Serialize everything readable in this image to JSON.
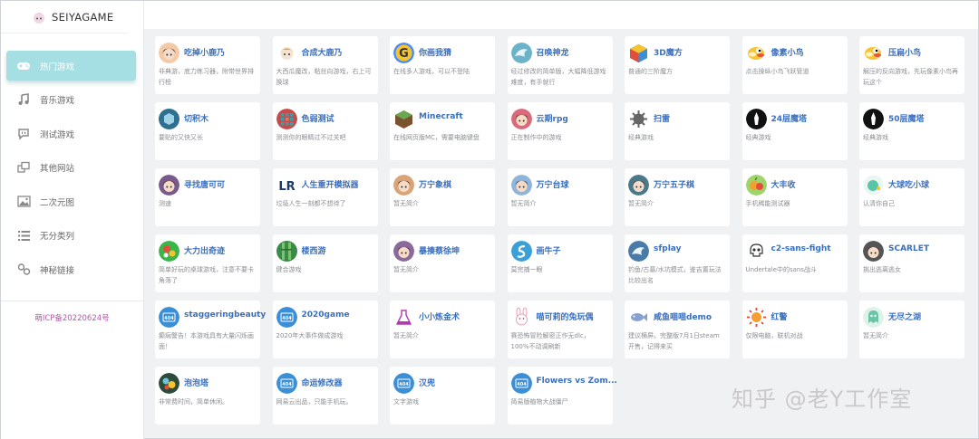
{
  "app": {
    "logo_text": "SEIYAGAME",
    "icp": "萌ICP备20220624号"
  },
  "sidebar": {
    "items": [
      {
        "label": "热门游戏",
        "icon": "gamepad-icon",
        "active": true
      },
      {
        "label": "音乐游戏",
        "icon": "music-note-icon",
        "active": false
      },
      {
        "label": "测试游戏",
        "icon": "chat-icon",
        "active": false
      },
      {
        "label": "其他网站",
        "icon": "windows-icon",
        "active": false
      },
      {
        "label": "二次元图",
        "icon": "image-icon",
        "active": false
      },
      {
        "label": "无分类列",
        "icon": "list-icon",
        "active": false
      },
      {
        "label": "神秘链接",
        "icon": "link-icon",
        "active": false
      }
    ]
  },
  "games": [
    {
      "title": "吃掉小鹿乃",
      "desc": "非典游，底力练习器，附带世界排行榜",
      "icon": "anime-girl-icon",
      "color": "#f4c9a8"
    },
    {
      "title": "合成大鹿乃",
      "desc": "大西瓜魔改，粘丝向游戏，右上可换球",
      "icon": "chibi-icon",
      "color": "#f2e4d0"
    },
    {
      "title": "你画我猜",
      "desc": "在线多人游戏，可以不登陆",
      "icon": "g-logo-icon",
      "color": "#4b8bf5"
    },
    {
      "title": "召唤神龙",
      "desc": "经过修改的简单版，大幅降低游戏难度，有手就行",
      "icon": "dragon-icon",
      "color": "#6ab3c9"
    },
    {
      "title": "3D魔方",
      "desc": "普通的三阶魔方",
      "icon": "rubik-cube-icon",
      "color": "#e44d3a"
    },
    {
      "title": "像素小鸟",
      "desc": "点击操纵小鸟飞跃管道",
      "icon": "flappy-bird-icon",
      "color": "#f6c43a"
    },
    {
      "title": "压扁小鸟",
      "desc": "解压的反向游戏，先玩像素小鸟再玩这个",
      "icon": "flappy-bird-icon",
      "color": "#f6c43a"
    },
    {
      "title": "切积木",
      "desc": "要贴的又快又长",
      "icon": "cube-icon",
      "color": "#2f6f8f"
    },
    {
      "title": "色弱测试",
      "desc": "测测你的眼睛过不过关吧",
      "icon": "grid-icon",
      "color": "#c94a4a"
    },
    {
      "title": "Minecraft",
      "desc": "在线网页版MC，需要电脑键盘",
      "icon": "grass-block-icon",
      "color": "#6aa84f"
    },
    {
      "title": "云期rpg",
      "desc": "正在制作中的游戏",
      "icon": "anime-girl-icon",
      "color": "#d86a7a"
    },
    {
      "title": "扫雷",
      "desc": "经典游戏",
      "icon": "mine-icon",
      "color": "#888888"
    },
    {
      "title": "24层魔塔",
      "desc": "经典游戏",
      "icon": "tower-icon",
      "color": "#111111"
    },
    {
      "title": "50层魔塔",
      "desc": "经典游戏",
      "icon": "tower-icon",
      "color": "#111111"
    },
    {
      "title": "寻找唐可可",
      "desc": "测速",
      "icon": "anime-face-icon",
      "color": "#7a5a8a"
    },
    {
      "title": "人生重开模拟器",
      "desc": "垃圾人生一刻都不想待了",
      "icon": "lr-logo-icon",
      "color": "#ffffff"
    },
    {
      "title": "万宁象棋",
      "desc": "暂无简介",
      "icon": "anime-face-icon",
      "color": "#d9a47a"
    },
    {
      "title": "万宁台球",
      "desc": "暂无简介",
      "icon": "anime-face-icon",
      "color": "#8fb6d9"
    },
    {
      "title": "万宁五子棋",
      "desc": "暂无简介",
      "icon": "anime-face-icon",
      "color": "#4a7a8a"
    },
    {
      "title": "大丰收",
      "desc": "手机稀能测试器",
      "icon": "fruit-icon",
      "color": "#e8b43a"
    },
    {
      "title": "大球吃小球",
      "desc": "认清你自己",
      "icon": "ball-icon",
      "color": "#58c4a8"
    },
    {
      "title": "大力出奇迹",
      "desc": "简单好玩的桌球游戏，注意不要卡角落了",
      "icon": "billiard-icon",
      "color": "#3ab54a"
    },
    {
      "title": "楼西游",
      "desc": "健合游戏",
      "icon": "bamboo-icon",
      "color": "#3a8a4a"
    },
    {
      "title": "暴揍蔡徐坤",
      "desc": "暂无简介",
      "icon": "anime-face-icon",
      "color": "#8a6a9a"
    },
    {
      "title": "画牛子",
      "desc": "莫完捕一眼",
      "icon": "s-curve-icon",
      "color": "#3aa0d9"
    },
    {
      "title": "sfplay",
      "desc": "钓鱼/古墓/水坑模式，鉴吉置玩法比较出名",
      "icon": "dragon-icon",
      "color": "#4a7aa8"
    },
    {
      "title": "c2-sans-fight",
      "desc": "Undertale中的sans战斗",
      "icon": "skull-icon",
      "color": "#ffffff"
    },
    {
      "title": "SCARLET",
      "desc": "挑出逃离逃女",
      "icon": "anime-face-icon",
      "color": "#555555"
    },
    {
      "title": "staggeringbeauty",
      "desc": "癫痫警告！本游戏具有大量闪烁画面！",
      "icon": "404-icon",
      "color": "#3a8fd6"
    },
    {
      "title": "2020game",
      "desc": "2020年大事件做成游戏",
      "icon": "404-icon",
      "color": "#3a8fd6"
    },
    {
      "title": "小小炼金术",
      "desc": "暂无简介",
      "icon": "flask-icon",
      "color": "#b03ab0"
    },
    {
      "title": "喵可莉的兔玩偶",
      "desc": "赛恐怖冒险解密正作无dlc，100%不动调刷新",
      "icon": "bunny-icon",
      "color": "#e8a0b0"
    },
    {
      "title": "咸鱼喵喵demo",
      "desc": "建议横屏。完整版7月1日steam开售，记得来买",
      "icon": "fish-icon",
      "color": "#8aa0d0"
    },
    {
      "title": "红警",
      "desc": "仅限电脑，联机对战",
      "icon": "sun-icon",
      "color": "#d94a3a"
    },
    {
      "title": "无尽之湖",
      "desc": "暂无简介",
      "icon": "ghost-icon",
      "color": "#6ac4a8"
    },
    {
      "title": "泡泡塔",
      "desc": "非常费时间，简单休闲。",
      "icon": "bubble-icon",
      "color": "#3a6a4a"
    },
    {
      "title": "命运修改器",
      "desc": "网易云出品，只能手机玩。",
      "icon": "404-icon",
      "color": "#3a8fd6"
    },
    {
      "title": "汉兜",
      "desc": "文字游戏",
      "icon": "404-icon",
      "color": "#3a8fd6"
    },
    {
      "title": "Flowers vs Zom...",
      "desc": "简易版植物大战僵尸",
      "icon": "404-icon",
      "color": "#3a8fd6"
    }
  ],
  "watermark": "知乎 @老Y工作室"
}
